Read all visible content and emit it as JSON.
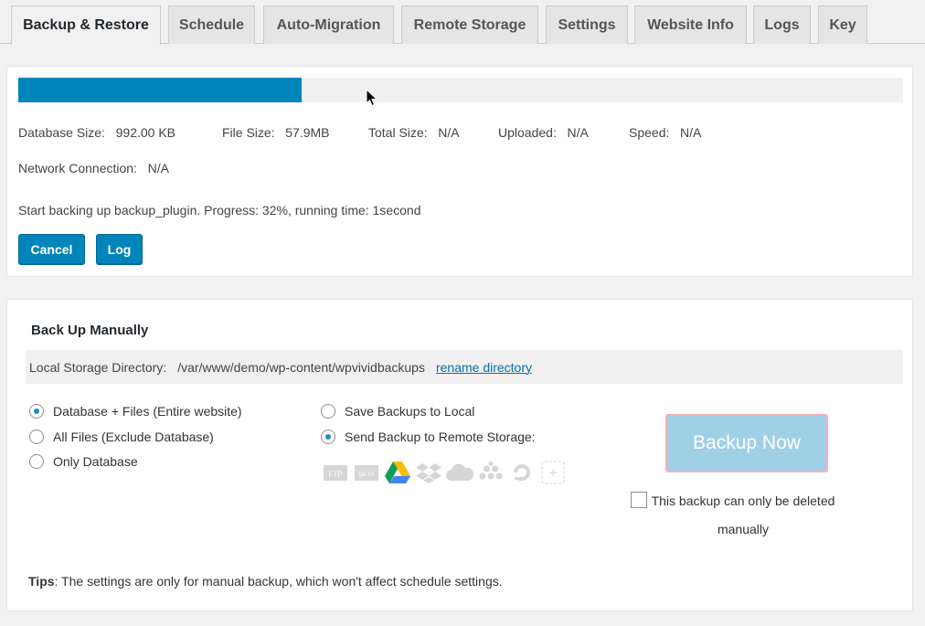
{
  "tabs": [
    {
      "label": "Backup & Restore",
      "active": true
    },
    {
      "label": "Schedule"
    },
    {
      "label": "Auto-Migration"
    },
    {
      "label": "Remote Storage"
    },
    {
      "label": "Settings"
    },
    {
      "label": "Website Info"
    },
    {
      "label": "Logs"
    },
    {
      "label": "Key"
    }
  ],
  "progress": {
    "percent": 32,
    "fill_color": "#0085ba",
    "stats": {
      "database_size_label": "Database Size:",
      "database_size_value": "992.00 KB",
      "file_size_label": "File Size:",
      "file_size_value": "57.9MB",
      "total_size_label": "Total Size:",
      "total_size_value": "N/A",
      "uploaded_label": "Uploaded:",
      "uploaded_value": "N/A",
      "speed_label": "Speed:",
      "speed_value": "N/A",
      "network_label": "Network Connection:",
      "network_value": "N/A"
    },
    "status_text": "Start backing up backup_plugin. Progress: 32%, running time: 1second",
    "cancel_label": "Cancel",
    "log_label": "Log"
  },
  "manual": {
    "title": "Back Up Manually",
    "storage_label": "Local Storage Directory:",
    "storage_path": "/var/www/demo/wp-content/wpvividbackups",
    "rename_link": "rename directory",
    "content_options": [
      {
        "label": "Database + Files (Entire website)",
        "checked": true
      },
      {
        "label": "All Files (Exclude Database)",
        "checked": false
      },
      {
        "label": "Only Database",
        "checked": false
      }
    ],
    "destination_options": [
      {
        "label": "Save Backups to Local",
        "checked": false
      },
      {
        "label": "Send Backup to Remote Storage:",
        "checked": true
      }
    ],
    "storage_icons": {
      "ftp": "FTP",
      "sftp": "SFTP",
      "google_drive": "google-drive-icon",
      "dropbox": "dropbox-icon",
      "onedrive": "onedrive-icon",
      "s3": "amazon-s3-icon",
      "digitalocean": "digitalocean-icon",
      "add": "+"
    },
    "backup_now_label": "Backup Now",
    "delete_manually_label": "This backup can only be deleted manually",
    "tips_label": "Tips",
    "tips_text": ": The settings are only for manual backup, which won't affect schedule settings."
  }
}
